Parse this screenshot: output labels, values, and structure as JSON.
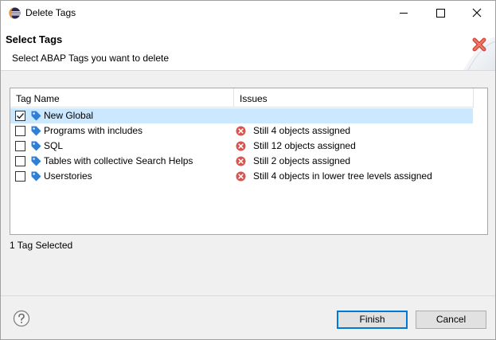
{
  "window": {
    "title": "Delete Tags"
  },
  "banner": {
    "title": "Select Tags",
    "message": "Select ABAP Tags you want to delete"
  },
  "table": {
    "columns": [
      "Tag Name",
      "Issues"
    ],
    "rows": [
      {
        "name": "New Global",
        "checked": true,
        "selected": true,
        "issue": ""
      },
      {
        "name": "Programs with includes",
        "checked": false,
        "selected": false,
        "issue": "Still 4 objects assigned"
      },
      {
        "name": "SQL",
        "checked": false,
        "selected": false,
        "issue": "Still 12 objects assigned"
      },
      {
        "name": "Tables with collective Search Helps",
        "checked": false,
        "selected": false,
        "issue": "Still 2 objects assigned"
      },
      {
        "name": "Userstories",
        "checked": false,
        "selected": false,
        "issue": "Still 4 objects in lower tree levels assigned"
      }
    ]
  },
  "status": "1 Tag Selected",
  "buttons": {
    "finish": "Finish",
    "cancel": "Cancel"
  },
  "colors": {
    "selection": "#cce8ff",
    "tag": "#2f7fd6",
    "error": "#d9534f",
    "default_button_border": "#0078d7"
  }
}
